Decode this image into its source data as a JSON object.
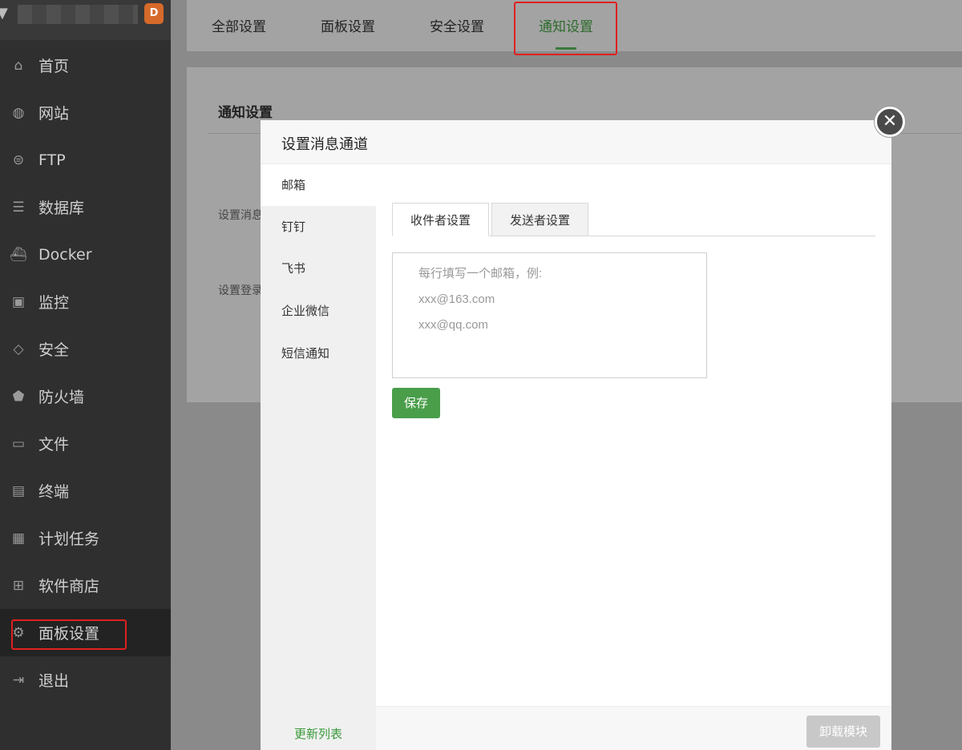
{
  "sidebar": {
    "badge": "D",
    "items": [
      {
        "label": "首页",
        "icon": "home-icon",
        "glyph": "⌂"
      },
      {
        "label": "网站",
        "icon": "globe-icon",
        "glyph": "◍"
      },
      {
        "label": "FTP",
        "icon": "ftp-icon",
        "glyph": "⊜"
      },
      {
        "label": "数据库",
        "icon": "database-icon",
        "glyph": "☰"
      },
      {
        "label": "Docker",
        "icon": "docker-icon",
        "glyph": "⛴"
      },
      {
        "label": "监控",
        "icon": "monitor-icon",
        "glyph": "▣"
      },
      {
        "label": "安全",
        "icon": "shield-check-icon",
        "glyph": "◇"
      },
      {
        "label": "防火墙",
        "icon": "firewall-icon",
        "glyph": "⬟"
      },
      {
        "label": "文件",
        "icon": "folder-icon",
        "glyph": "▭"
      },
      {
        "label": "终端",
        "icon": "terminal-icon",
        "glyph": "▤"
      },
      {
        "label": "计划任务",
        "icon": "calendar-icon",
        "glyph": "▦"
      },
      {
        "label": "软件商店",
        "icon": "apps-icon",
        "glyph": "⊞"
      },
      {
        "label": "面板设置",
        "icon": "gear-icon",
        "glyph": "⚙",
        "active": true
      },
      {
        "label": "退出",
        "icon": "logout-icon",
        "glyph": "⇥"
      }
    ]
  },
  "top_tabs": [
    {
      "label": "全部设置"
    },
    {
      "label": "面板设置"
    },
    {
      "label": "安全设置"
    },
    {
      "label": "通知设置",
      "active": true
    }
  ],
  "panel": {
    "title": "通知设置",
    "row1_label": "设置消息",
    "row2_label": "设置登录"
  },
  "modal": {
    "title": "设置消息通道",
    "close_glyph": "✕",
    "channels": [
      {
        "label": "邮箱",
        "active": true
      },
      {
        "label": "钉钉"
      },
      {
        "label": "飞书"
      },
      {
        "label": "企业微信"
      },
      {
        "label": "短信通知"
      }
    ],
    "channel_footer": "更新列表",
    "sub_tabs": [
      {
        "label": "收件者设置",
        "active": true
      },
      {
        "label": "发送者设置"
      }
    ],
    "email_placeholder_lines": [
      "每行填写一个邮箱，例:",
      "xxx@163.com",
      "xxx@qq.com"
    ],
    "save_label": "保存",
    "uninstall_label": "卸载模块"
  }
}
